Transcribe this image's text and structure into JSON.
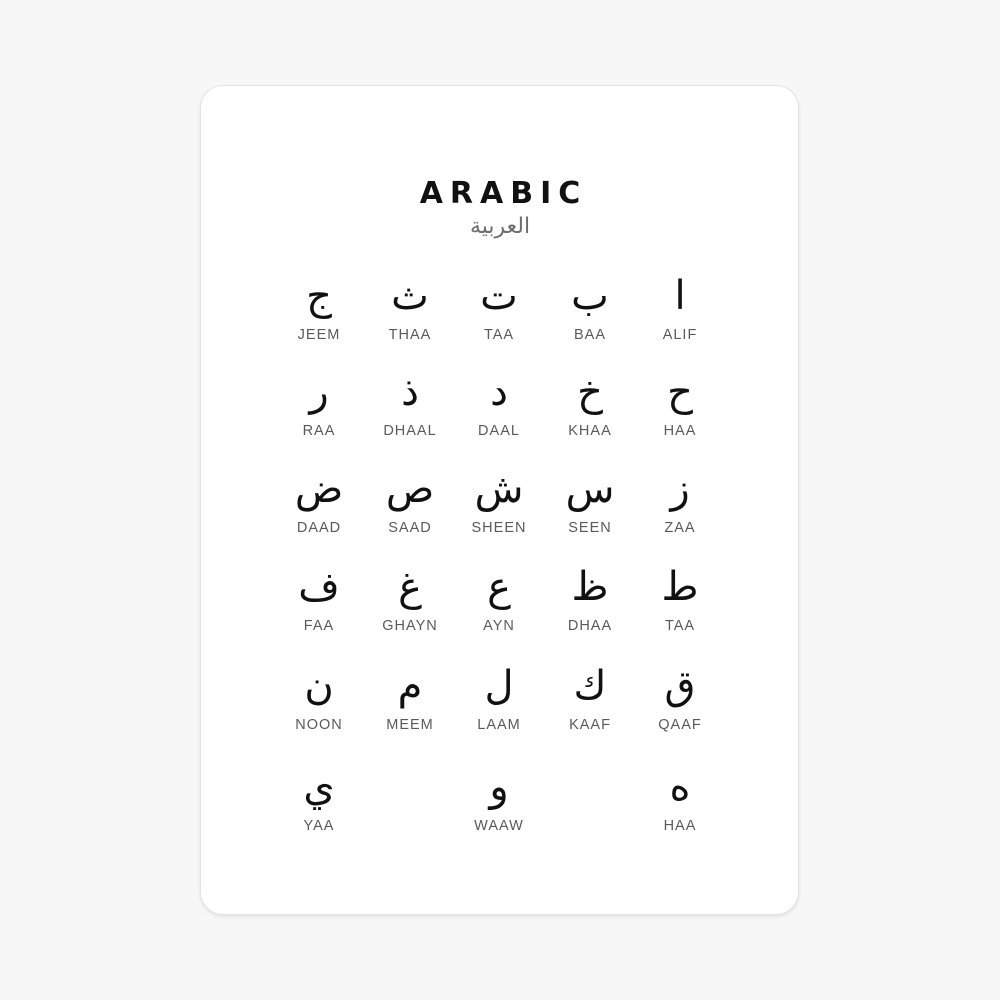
{
  "title": "ARABIC",
  "subtitle": "العربية",
  "letters": [
    {
      "glyph": "ا",
      "name": "ALIF"
    },
    {
      "glyph": "ب",
      "name": "BAA"
    },
    {
      "glyph": "ت",
      "name": "TAA"
    },
    {
      "glyph": "ث",
      "name": "THAA"
    },
    {
      "glyph": "ج",
      "name": "JEEM"
    },
    {
      "glyph": "ح",
      "name": "HAA"
    },
    {
      "glyph": "خ",
      "name": "KHAA"
    },
    {
      "glyph": "د",
      "name": "DAAL"
    },
    {
      "glyph": "ذ",
      "name": "DHAAL"
    },
    {
      "glyph": "ر",
      "name": "RAA"
    },
    {
      "glyph": "ز",
      "name": "ZAA"
    },
    {
      "glyph": "س",
      "name": "SEEN"
    },
    {
      "glyph": "ش",
      "name": "SHEEN"
    },
    {
      "glyph": "ص",
      "name": "SAAD"
    },
    {
      "glyph": "ض",
      "name": "DAAD"
    },
    {
      "glyph": "ط",
      "name": "TAA"
    },
    {
      "glyph": "ظ",
      "name": "DHAA"
    },
    {
      "glyph": "ع",
      "name": "AYN"
    },
    {
      "glyph": "غ",
      "name": "GHAYN"
    },
    {
      "glyph": "ف",
      "name": "FAA"
    },
    {
      "glyph": "ق",
      "name": "QAAF"
    },
    {
      "glyph": "ك",
      "name": "KAAF"
    },
    {
      "glyph": "ل",
      "name": "LAAM"
    },
    {
      "glyph": "م",
      "name": "MEEM"
    },
    {
      "glyph": "ن",
      "name": "NOON"
    },
    {
      "glyph": "ه",
      "name": "HAA"
    },
    {
      "glyph": "و",
      "name": "WAAW"
    },
    {
      "glyph": "ي",
      "name": "YAA"
    }
  ]
}
